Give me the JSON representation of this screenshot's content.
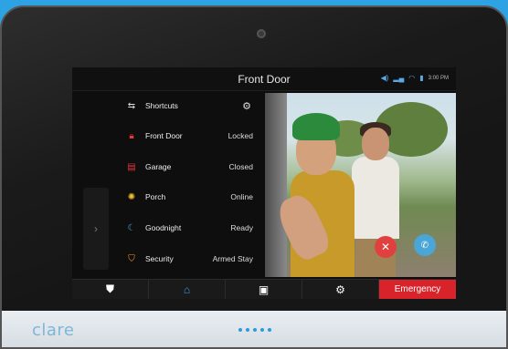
{
  "screen": {
    "title": "Front Door",
    "status_time": "3:00 PM"
  },
  "shortcuts_header": {
    "label": "Shortcuts",
    "icon": "shortcuts-icon",
    "settings_icon": "gear-icon"
  },
  "devices": [
    {
      "label": "Front Door",
      "value": "Locked",
      "icon": "lock-icon",
      "color": "#e2373b"
    },
    {
      "label": "Garage",
      "value": "Closed",
      "icon": "garage-icon",
      "color": "#e2373b"
    },
    {
      "label": "Porch",
      "value": "Online",
      "icon": "lightbulb-icon",
      "color": "#f2c12e"
    },
    {
      "label": "Goodnight",
      "value": "Ready",
      "icon": "moon-icon",
      "color": "#4aa6d6"
    },
    {
      "label": "Security",
      "value": "Armed Stay",
      "icon": "shield-icon",
      "color": "#f2a51e"
    }
  ],
  "video": {
    "decline_icon": "close-icon",
    "answer_icon": "phone-icon"
  },
  "navbar": {
    "items": [
      "security-icon",
      "home-icon",
      "camera-icon",
      "gear-icon"
    ],
    "emergency_label": "Emergency"
  },
  "brand": "clare",
  "colors": {
    "accent": "#3d9be0",
    "emergency": "#d9232a",
    "background": "#2ea3e3"
  }
}
